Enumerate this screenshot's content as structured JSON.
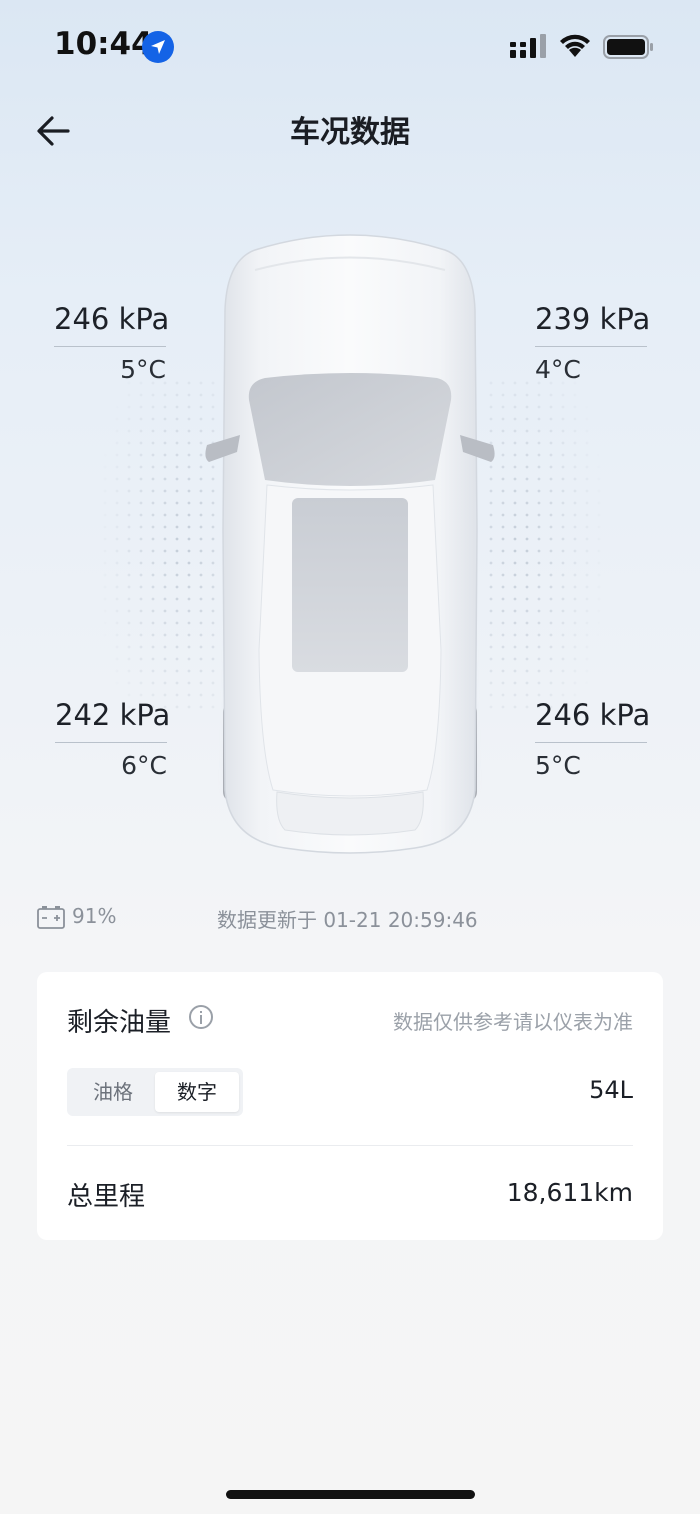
{
  "status_bar": {
    "time": "10:44"
  },
  "header": {
    "title": "车况数据"
  },
  "tires": {
    "front_left": {
      "pressure": "246 kPa",
      "temp": "5°C"
    },
    "front_right": {
      "pressure": "239 kPa",
      "temp": "4°C"
    },
    "rear_left": {
      "pressure": "242 kPa",
      "temp": "6°C"
    },
    "rear_right": {
      "pressure": "246 kPa",
      "temp": "5°C"
    }
  },
  "info": {
    "battery": "91%",
    "updated": "数据更新于 01-21 20:59:46"
  },
  "fuel_card": {
    "title": "剩余油量",
    "note": "数据仅供参考请以仪表为准",
    "segment": {
      "options": [
        "油格",
        "数字"
      ],
      "selected": "数字"
    },
    "fuel_value": "54L",
    "mileage_label": "总里程",
    "mileage_value": "18,611km"
  },
  "colors": {
    "accent": "#1463e6",
    "text": "#1b1f26",
    "muted": "#8b919a"
  }
}
